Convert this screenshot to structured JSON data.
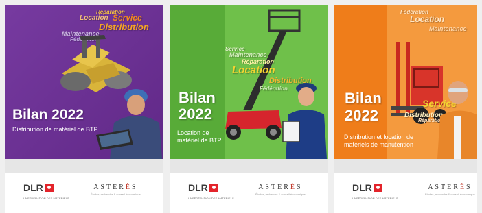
{
  "colors": {
    "purple": "#6e2e9a",
    "green": "#5bb33a",
    "orange": "#ef7d1a",
    "accent_orange": "#f28a1e",
    "accent_yellow": "#f5d330",
    "page_bg": "#efefef"
  },
  "cards": [
    {
      "title": "Bilan 2022",
      "subtitle": "Distribution de matériel de BTP",
      "words": [
        "Réparation",
        "Location",
        "Service",
        "Distribution",
        "Maintenance",
        "Fédération"
      ],
      "illustration": "road-roller-and-worker",
      "logo_left": {
        "name": "DLR",
        "tagline": "LA FÉDÉRATION DES MATÉRIELS"
      },
      "logo_right": {
        "name_prefix": "ASTER",
        "name_accent": "È",
        "name_suffix": "S",
        "tagline": "Études, recherche & conseil économique"
      }
    },
    {
      "title_line1": "Bilan",
      "title_line2": "2022",
      "subtitle_line1": "Location de",
      "subtitle_line2": "matériel de BTP",
      "words": [
        "Service",
        "Maintenance",
        "Réparation",
        "Location",
        "Distribution",
        "Fédération"
      ],
      "illustration": "aerial-lift-and-woman",
      "logo_left": {
        "name": "DLR",
        "tagline": "LA FÉDÉRATION DES MATÉRIELS"
      },
      "logo_right": {
        "name_prefix": "ASTER",
        "name_accent": "È",
        "name_suffix": "S",
        "tagline": "Études, recherche & conseil économique"
      }
    },
    {
      "title_line1": "Bilan",
      "title_line2": "2022",
      "subtitle_line1": "Distribution et location de",
      "subtitle_line2": "matériels de manutention",
      "words": [
        "Fédération",
        "Location",
        "Maintenance",
        "Service",
        "Distribution",
        "Réparation"
      ],
      "illustration": "forklift-and-worker",
      "logo_left": {
        "name": "DLR",
        "tagline": "LA FÉDÉRATION DES MATÉRIELS"
      },
      "logo_right": {
        "name_prefix": "ASTER",
        "name_accent": "È",
        "name_suffix": "S",
        "tagline": "Études, recherche & conseil économique"
      }
    }
  ]
}
